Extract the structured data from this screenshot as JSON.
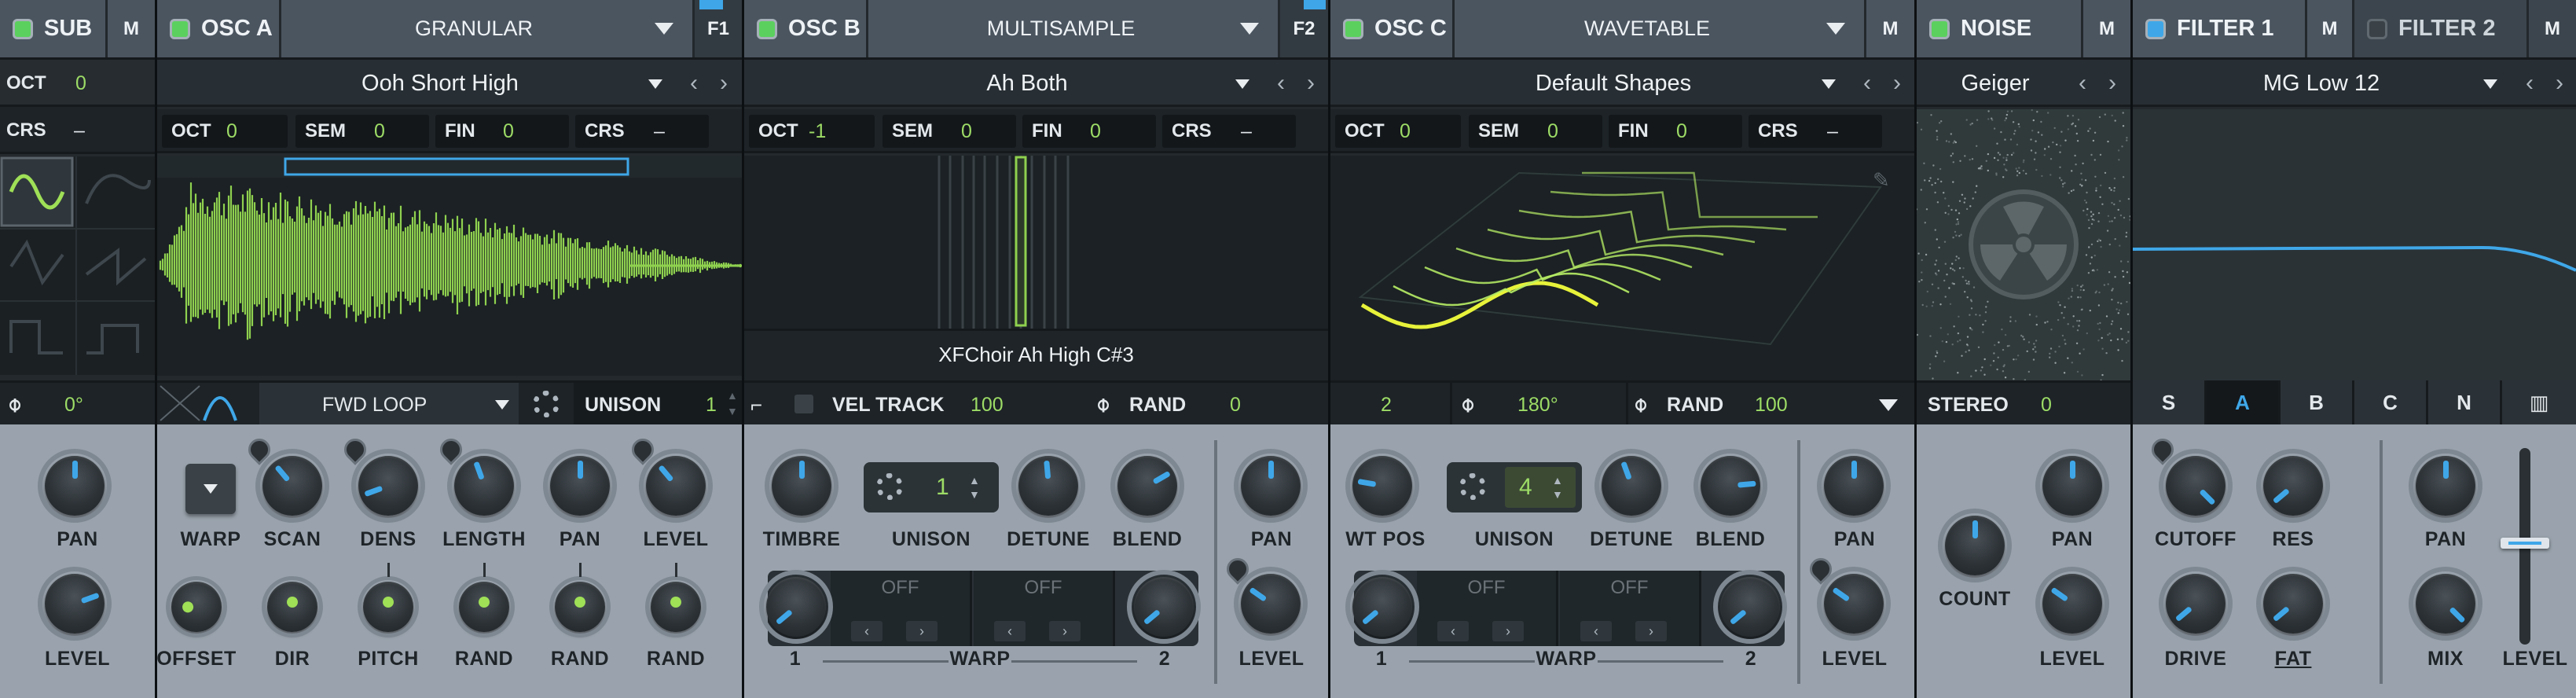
{
  "sub": {
    "name": "SUB",
    "mute": "M",
    "oct_label": "OCT",
    "oct_value": "0",
    "crs_label": "CRS",
    "crs_value": "–",
    "phase_value": "0°",
    "pan_label": "PAN",
    "level_label": "LEVEL",
    "shapes": [
      "sine",
      "soft-saw",
      "triangle",
      "saw",
      "square",
      "pulse"
    ]
  },
  "osc_a": {
    "name": "OSC A",
    "mode": "GRANULAR",
    "fx_tag": "F1",
    "preset": "Ooh Short High",
    "oct_label": "OCT",
    "oct_value": "0",
    "sem_label": "SEM",
    "sem_value": "0",
    "fin_label": "FIN",
    "fin_value": "0",
    "crs_label": "CRS",
    "crs_value": "–",
    "loop_mode": "FWD LOOP",
    "unison_label": "UNISON",
    "unison_value": "1",
    "warp_label": "WARP",
    "knobs_top": [
      "SCAN",
      "DENS",
      "LENGTH",
      "PAN",
      "LEVEL"
    ],
    "knobs_bottom": [
      "OFFSET",
      "DIR",
      "PITCH",
      "RAND",
      "RAND",
      "RAND"
    ]
  },
  "osc_b": {
    "name": "OSC B",
    "mode": "MULTISAMPLE",
    "fx_tag": "F2",
    "preset": "Ah Both",
    "oct_label": "OCT",
    "oct_value": "-1",
    "sem_label": "SEM",
    "sem_value": "0",
    "fin_label": "FIN",
    "fin_value": "0",
    "crs_label": "CRS",
    "crs_value": "–",
    "sample_name": "XFChoir Ah High C#3",
    "vel_track_label": "VEL TRACK",
    "vel_track_value": "100",
    "rand_label": "RAND",
    "rand_value": "0",
    "timbre_label": "TIMBRE",
    "unison_label": "UNISON",
    "unison_value": "1",
    "detune_label": "DETUNE",
    "blend_label": "BLEND",
    "pan_label": "PAN",
    "level_label": "LEVEL",
    "warp_label": "WARP",
    "warp1": "1",
    "warp2": "2",
    "slot_off_1": "OFF",
    "slot_off_2": "OFF"
  },
  "osc_c": {
    "name": "OSC C",
    "mode": "WAVETABLE",
    "mute": "M",
    "preset": "Default Shapes",
    "oct_label": "OCT",
    "oct_value": "0",
    "sem_label": "SEM",
    "sem_value": "0",
    "fin_label": "FIN",
    "fin_value": "0",
    "crs_label": "CRS",
    "crs_value": "–",
    "frame_value": "2",
    "phase_value": "180°",
    "rand_label": "RAND",
    "rand_value": "100",
    "wtpos_label": "WT POS",
    "unison_label": "UNISON",
    "unison_value": "4",
    "detune_label": "DETUNE",
    "blend_label": "BLEND",
    "pan_label": "PAN",
    "level_label": "LEVEL",
    "warp_label": "WARP",
    "warp1": "1",
    "warp2": "2",
    "slot_off_1": "OFF",
    "slot_off_2": "OFF"
  },
  "noise": {
    "name": "NOISE",
    "mute": "M",
    "preset": "Geiger",
    "stereo_label": "STEREO",
    "stereo_value": "0",
    "count_label": "COUNT",
    "pan_label": "PAN",
    "level_label": "LEVEL"
  },
  "filter1": {
    "name": "FILTER 1",
    "mute": "M",
    "preset": "MG Low 12",
    "slopes": [
      "S",
      "A",
      "B",
      "C",
      "N"
    ],
    "selected_slope": "A",
    "cutoff_label": "CUTOFF",
    "res_label": "RES",
    "pan_label": "PAN",
    "drive_label": "DRIVE",
    "fat_label": "FAT",
    "mix_label": "MIX",
    "level_label": "LEVEL"
  },
  "filter2": {
    "name": "FILTER 2",
    "mute": "M"
  },
  "colors": {
    "accent": "#3fa7e8",
    "led_on": "#5bd05e",
    "wave": "#8fd14f",
    "wt_line": "#b9f066",
    "wt_highlight": "#e7f23a"
  }
}
